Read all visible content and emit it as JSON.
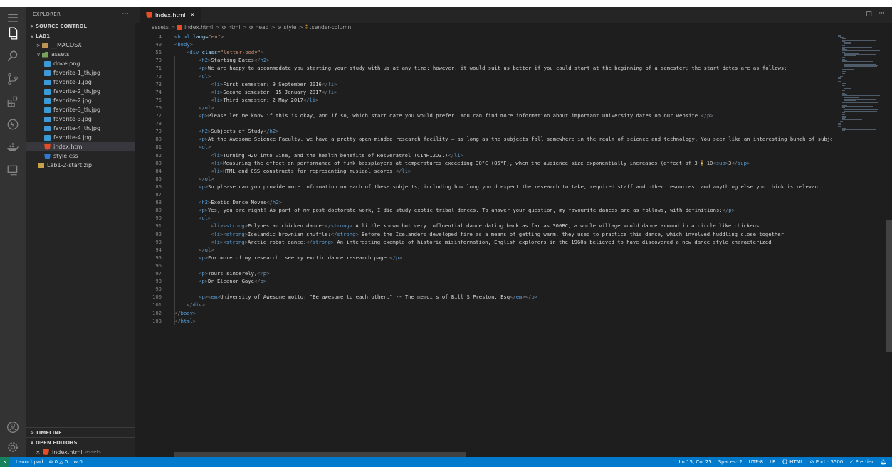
{
  "sidebar": {
    "title": "EXPLORER",
    "more": "···",
    "source_control": "SOURCE CONTROL",
    "tree": [
      {
        "label": "LAB1",
        "depth": 0,
        "type": "root",
        "expanded": true
      },
      {
        "label": "__MACOSX",
        "depth": 1,
        "type": "folder",
        "expanded": false
      },
      {
        "label": "assets",
        "depth": 1,
        "type": "folder-green",
        "expanded": true
      },
      {
        "label": "dove.png",
        "depth": 2,
        "type": "img"
      },
      {
        "label": "favorite-1_th.jpg",
        "depth": 2,
        "type": "img"
      },
      {
        "label": "favorite-1.jpg",
        "depth": 2,
        "type": "img"
      },
      {
        "label": "favorite-2_th.jpg",
        "depth": 2,
        "type": "img"
      },
      {
        "label": "favorite-2.jpg",
        "depth": 2,
        "type": "img"
      },
      {
        "label": "favorite-3_th.jpg",
        "depth": 2,
        "type": "img"
      },
      {
        "label": "favorite-3.jpg",
        "depth": 2,
        "type": "img"
      },
      {
        "label": "favorite-4_th.jpg",
        "depth": 2,
        "type": "img"
      },
      {
        "label": "favorite-4.jpg",
        "depth": 2,
        "type": "img"
      },
      {
        "label": "index.html",
        "depth": 2,
        "type": "html",
        "selected": true
      },
      {
        "label": "style.css",
        "depth": 2,
        "type": "css"
      },
      {
        "label": "Lab1-2-start.zip",
        "depth": 1,
        "type": "zip"
      }
    ],
    "timeline": "TIMELINE",
    "open_editors": "OPEN EDITORS",
    "open_file": "index.html",
    "open_file_dir": "assets"
  },
  "tab": {
    "label": "index.html",
    "close": "×"
  },
  "breadcrumbs": [
    "assets",
    "index.html",
    "html",
    "head",
    "style",
    ".sender-column"
  ],
  "editor": {
    "lines": [
      {
        "n": "4",
        "i": 0,
        "t": [
          [
            "br",
            "<"
          ],
          [
            "tag",
            "html"
          ],
          [
            "d",
            " "
          ],
          [
            "attr",
            "lang"
          ],
          [
            "d",
            "="
          ],
          [
            "str",
            "\"en\""
          ],
          [
            "br",
            ">"
          ]
        ],
        "sticky": true
      },
      {
        "n": "40",
        "i": 0,
        "t": [
          [
            "br",
            "<"
          ],
          [
            "tag",
            "body"
          ],
          [
            "br",
            ">"
          ]
        ],
        "sticky": true
      },
      {
        "n": "56",
        "i": 1,
        "t": [
          [
            "br",
            "<"
          ],
          [
            "tag",
            "div"
          ],
          [
            "d",
            " "
          ],
          [
            "attr",
            "class"
          ],
          [
            "d",
            "="
          ],
          [
            "str",
            "\"letter-body\""
          ],
          [
            "br",
            ">"
          ]
        ],
        "sticky": true
      },
      {
        "n": "70",
        "i": 2,
        "t": [
          [
            "br",
            "<"
          ],
          [
            "tag",
            "h2"
          ],
          [
            "br",
            ">"
          ],
          [
            "d",
            "Starting Dates"
          ],
          [
            "br",
            "</"
          ],
          [
            "tag",
            "h2"
          ],
          [
            "br",
            ">"
          ]
        ]
      },
      {
        "n": "71",
        "i": 2,
        "t": [
          [
            "br",
            "<"
          ],
          [
            "tag",
            "p"
          ],
          [
            "br",
            ">"
          ],
          [
            "d",
            "We are happy to accommodate you starting your study with us at any time; however, it would suit us better if you could start at the beginning of a semester; the start dates are as follows:"
          ]
        ]
      },
      {
        "n": "72",
        "i": 2,
        "t": [
          [
            "br",
            "<"
          ],
          [
            "tag",
            "ul"
          ],
          [
            "br",
            ">"
          ]
        ]
      },
      {
        "n": "73",
        "i": 3,
        "t": [
          [
            "br",
            "<"
          ],
          [
            "tag",
            "li"
          ],
          [
            "br",
            ">"
          ],
          [
            "d",
            "First semester: 9 September 2016"
          ],
          [
            "br",
            "</"
          ],
          [
            "tag",
            "li"
          ],
          [
            "br",
            ">"
          ]
        ]
      },
      {
        "n": "74",
        "i": 3,
        "t": [
          [
            "br",
            "<"
          ],
          [
            "tag",
            "li"
          ],
          [
            "br",
            ">"
          ],
          [
            "d",
            "Second semester: 15 January 2017"
          ],
          [
            "br",
            "</"
          ],
          [
            "tag",
            "li"
          ],
          [
            "br",
            ">"
          ]
        ]
      },
      {
        "n": "75",
        "i": 3,
        "t": [
          [
            "br",
            "<"
          ],
          [
            "tag",
            "li"
          ],
          [
            "br",
            ">"
          ],
          [
            "d",
            "Third semester: 2 May 2017"
          ],
          [
            "br",
            "</"
          ],
          [
            "tag",
            "li"
          ],
          [
            "br",
            ">"
          ]
        ]
      },
      {
        "n": "76",
        "i": 2,
        "t": [
          [
            "br",
            "</"
          ],
          [
            "tag",
            "ul"
          ],
          [
            "br",
            ">"
          ]
        ]
      },
      {
        "n": "77",
        "i": 2,
        "t": [
          [
            "br",
            "<"
          ],
          [
            "tag",
            "p"
          ],
          [
            "br",
            ">"
          ],
          [
            "d",
            "Please let me know if this is okay, and if so, which start date you would prefer. You can find more information about important university dates on our website."
          ],
          [
            "br",
            "</"
          ],
          [
            "tag",
            "p"
          ],
          [
            "br",
            ">"
          ]
        ]
      },
      {
        "n": "78",
        "i": 2,
        "t": []
      },
      {
        "n": "79",
        "i": 2,
        "t": [
          [
            "br",
            "<"
          ],
          [
            "tag",
            "h2"
          ],
          [
            "br",
            ">"
          ],
          [
            "d",
            "Subjects of Study"
          ],
          [
            "br",
            "</"
          ],
          [
            "tag",
            "h2"
          ],
          [
            "br",
            ">"
          ]
        ]
      },
      {
        "n": "80",
        "i": 2,
        "t": [
          [
            "br",
            "<"
          ],
          [
            "tag",
            "p"
          ],
          [
            "br",
            ">"
          ],
          [
            "d",
            "At the Awesome Science Faculty, we have a pretty open-minded research facility — as long as the subjects fall somewhere in the realm of science and technology. You seem like an interesting bunch of subjects:"
          ]
        ]
      },
      {
        "n": "81",
        "i": 2,
        "t": [
          [
            "br",
            "<"
          ],
          [
            "tag",
            "ol"
          ],
          [
            "br",
            ">"
          ]
        ]
      },
      {
        "n": "82",
        "i": 3,
        "t": [
          [
            "br",
            "<"
          ],
          [
            "tag",
            "li"
          ],
          [
            "br",
            ">"
          ],
          [
            "d",
            "Turning H2O into wine, and the health benefits of Resveratrol (C14H12O3.)"
          ],
          [
            "br",
            "</"
          ],
          [
            "tag",
            "li"
          ],
          [
            "br",
            ">"
          ]
        ]
      },
      {
        "n": "83",
        "i": 3,
        "t": [
          [
            "br",
            "<"
          ],
          [
            "tag",
            "li"
          ],
          [
            "br",
            ">"
          ],
          [
            "d",
            "Measuring the effect on performance of funk bassplayers at temperatures exceeding 30°C (86°F), when the audience size exponentially increases (effect of 3 "
          ],
          [
            "warn",
            "×"
          ],
          [
            "d",
            " 10"
          ],
          [
            "br",
            "<"
          ],
          [
            "tag",
            "sup"
          ],
          [
            "br",
            ">"
          ],
          [
            "d",
            "3"
          ],
          [
            "br",
            "</"
          ],
          [
            "tag",
            "sup"
          ],
          [
            "br",
            ">"
          ]
        ]
      },
      {
        "n": "84",
        "i": 3,
        "t": [
          [
            "br",
            "<"
          ],
          [
            "tag",
            "li"
          ],
          [
            "br",
            ">"
          ],
          [
            "d",
            "HTML and CSS constructs for representing musical scores."
          ],
          [
            "br",
            "</"
          ],
          [
            "tag",
            "li"
          ],
          [
            "br",
            ">"
          ]
        ]
      },
      {
        "n": "85",
        "i": 2,
        "t": [
          [
            "br",
            "</"
          ],
          [
            "tag",
            "ol"
          ],
          [
            "br",
            ">"
          ]
        ]
      },
      {
        "n": "86",
        "i": 2,
        "t": [
          [
            "br",
            "<"
          ],
          [
            "tag",
            "p"
          ],
          [
            "br",
            ">"
          ],
          [
            "d",
            "So please can you provide more information on each of these subjects, including how long you'd expect the research to take, required staff and other resources, and anything else you think is relevant."
          ]
        ]
      },
      {
        "n": "87",
        "i": 2,
        "t": []
      },
      {
        "n": "88",
        "i": 2,
        "t": [
          [
            "br",
            "<"
          ],
          [
            "tag",
            "h2"
          ],
          [
            "br",
            ">"
          ],
          [
            "d",
            "Exotic Dance Moves"
          ],
          [
            "br",
            "</"
          ],
          [
            "tag",
            "h2"
          ],
          [
            "br",
            ">"
          ]
        ]
      },
      {
        "n": "89",
        "i": 2,
        "t": [
          [
            "br",
            "<"
          ],
          [
            "tag",
            "p"
          ],
          [
            "br",
            ">"
          ],
          [
            "d",
            "Yes, you are right! As part of my post-doctorate work, I did study exotic tribal dances. To answer your question, my favourite dances are as follows, with definitions:"
          ],
          [
            "br",
            "</"
          ],
          [
            "tag",
            "p"
          ],
          [
            "br",
            ">"
          ]
        ]
      },
      {
        "n": "90",
        "i": 2,
        "t": [
          [
            "br",
            "<"
          ],
          [
            "tag",
            "ul"
          ],
          [
            "br",
            ">"
          ]
        ]
      },
      {
        "n": "91",
        "i": 3,
        "t": [
          [
            "br",
            "<"
          ],
          [
            "tag",
            "li"
          ],
          [
            "br",
            ">"
          ],
          [
            "br",
            "<"
          ],
          [
            "tag",
            "strong"
          ],
          [
            "br",
            ">"
          ],
          [
            "d",
            "Polynesian chicken dance:"
          ],
          [
            "br",
            "</"
          ],
          [
            "tag",
            "strong"
          ],
          [
            "br",
            ">"
          ],
          [
            "d",
            " A little known but very influential dance dating back as far as 300BC, a whole village would dance around in a circle like chickens"
          ]
        ]
      },
      {
        "n": "92",
        "i": 3,
        "t": [
          [
            "br",
            "<"
          ],
          [
            "tag",
            "li"
          ],
          [
            "br",
            ">"
          ],
          [
            "br",
            "<"
          ],
          [
            "tag",
            "strong"
          ],
          [
            "br",
            ">"
          ],
          [
            "d",
            "Icelandic brownian shuffle:"
          ],
          [
            "br",
            "</"
          ],
          [
            "tag",
            "strong"
          ],
          [
            "br",
            ">"
          ],
          [
            "d",
            " Before the Icelanders developed fire as a means of getting warm, they used to practice this dance, which involved huddling close together"
          ]
        ]
      },
      {
        "n": "93",
        "i": 3,
        "t": [
          [
            "br",
            "<"
          ],
          [
            "tag",
            "li"
          ],
          [
            "br",
            ">"
          ],
          [
            "br",
            "<"
          ],
          [
            "tag",
            "strong"
          ],
          [
            "br",
            ">"
          ],
          [
            "d",
            "Arctic robot dance:"
          ],
          [
            "br",
            "</"
          ],
          [
            "tag",
            "strong"
          ],
          [
            "br",
            ">"
          ],
          [
            "d",
            " An interesting example of historic misinformation, English explorers in the 1960s believed to have discovered a new dance style characterized"
          ]
        ]
      },
      {
        "n": "94",
        "i": 2,
        "t": [
          [
            "br",
            "</"
          ],
          [
            "tag",
            "ul"
          ],
          [
            "br",
            ">"
          ]
        ]
      },
      {
        "n": "95",
        "i": 2,
        "t": [
          [
            "br",
            "<"
          ],
          [
            "tag",
            "p"
          ],
          [
            "br",
            ">"
          ],
          [
            "d",
            "For more of my research, see my exotic dance research page."
          ],
          [
            "br",
            "</"
          ],
          [
            "tag",
            "p"
          ],
          [
            "br",
            ">"
          ]
        ]
      },
      {
        "n": "96",
        "i": 2,
        "t": []
      },
      {
        "n": "97",
        "i": 2,
        "t": [
          [
            "br",
            "<"
          ],
          [
            "tag",
            "p"
          ],
          [
            "br",
            ">"
          ],
          [
            "d",
            "Yours sincerely,"
          ],
          [
            "br",
            "</"
          ],
          [
            "tag",
            "p"
          ],
          [
            "br",
            ">"
          ]
        ]
      },
      {
        "n": "98",
        "i": 2,
        "t": [
          [
            "br",
            "<"
          ],
          [
            "tag",
            "p"
          ],
          [
            "br",
            ">"
          ],
          [
            "d",
            "Dr Eleanor Gaye"
          ],
          [
            "br",
            "</"
          ],
          [
            "tag",
            "p"
          ],
          [
            "br",
            ">"
          ]
        ]
      },
      {
        "n": "99",
        "i": 2,
        "t": []
      },
      {
        "n": "100",
        "i": 2,
        "t": [
          [
            "br",
            "<"
          ],
          [
            "tag",
            "p"
          ],
          [
            "br",
            ">"
          ],
          [
            "br",
            "<"
          ],
          [
            "tag",
            "em"
          ],
          [
            "br",
            ">"
          ],
          [
            "d",
            "University of Awesome motto: \"Be awesome to each other.\" -- The memoirs of Bill S Preston, Esq"
          ],
          [
            "br",
            "</"
          ],
          [
            "tag",
            "em"
          ],
          [
            "br",
            "></"
          ],
          [
            "tag",
            "p"
          ],
          [
            "br",
            ">"
          ]
        ]
      },
      {
        "n": "101",
        "i": 1,
        "t": [
          [
            "br",
            "</"
          ],
          [
            "tag",
            "div"
          ],
          [
            "br",
            ">"
          ]
        ]
      },
      {
        "n": "102",
        "i": 0,
        "t": [
          [
            "br",
            "</"
          ],
          [
            "tag",
            "body"
          ],
          [
            "br",
            ">"
          ]
        ]
      },
      {
        "n": "103",
        "i": 0,
        "t": [
          [
            "br",
            "</"
          ],
          [
            "tag",
            "html"
          ],
          [
            "br",
            ">"
          ]
        ]
      }
    ]
  },
  "statusbar": {
    "remote": "⚡",
    "launchpad": "Launchpad",
    "problems": "⊗ 0 △ 0",
    "ports": "ᴡ 0",
    "position": "Ln 15, Col 25",
    "spaces": "Spaces: 2",
    "encoding": "UTF-8",
    "eol": "LF",
    "language": "{} HTML",
    "port": "⊘ Port : 5500",
    "prettier": "✓ Prettier"
  },
  "colors": {
    "accent": "#007acc",
    "editor_bg": "#1e1e1e",
    "sidebar_bg": "#252526",
    "activity_bg": "#333333"
  }
}
